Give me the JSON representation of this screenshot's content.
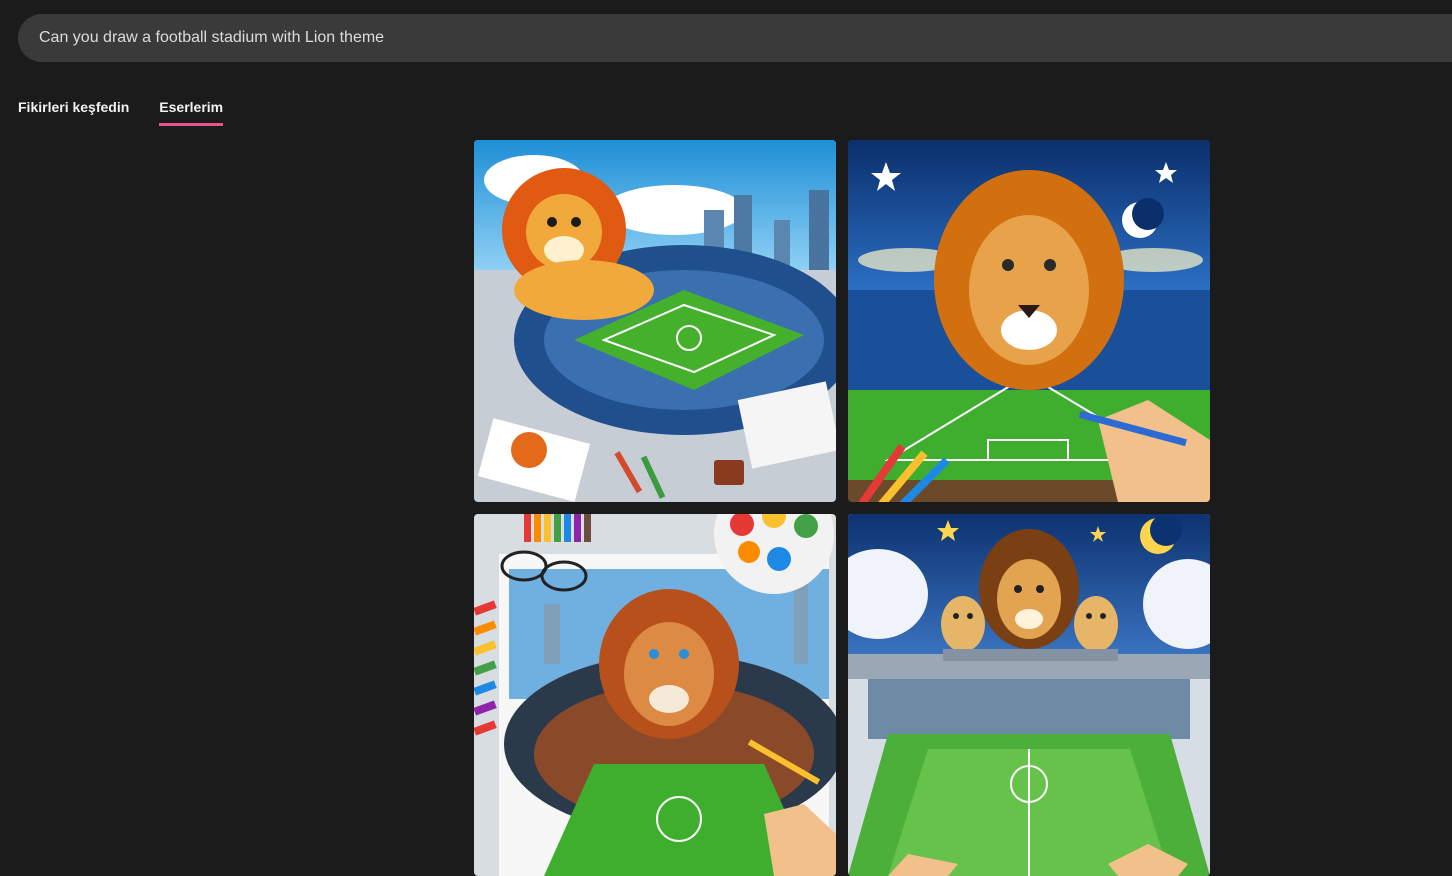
{
  "prompt": {
    "text": "Can you draw a football stadium with Lion theme"
  },
  "tabs": [
    {
      "label": "Fikirleri keşfedin",
      "active": false
    },
    {
      "label": "Eserlerim",
      "active": true
    }
  ],
  "accent_color": "#e5558a",
  "images": [
    {
      "name": "lion-cartoon-stadium-daytime"
    },
    {
      "name": "lion-face-stadium-night-stars"
    },
    {
      "name": "lion-drawing-stadium-color-palette"
    },
    {
      "name": "lion-family-stadium-crescent-moon"
    }
  ]
}
